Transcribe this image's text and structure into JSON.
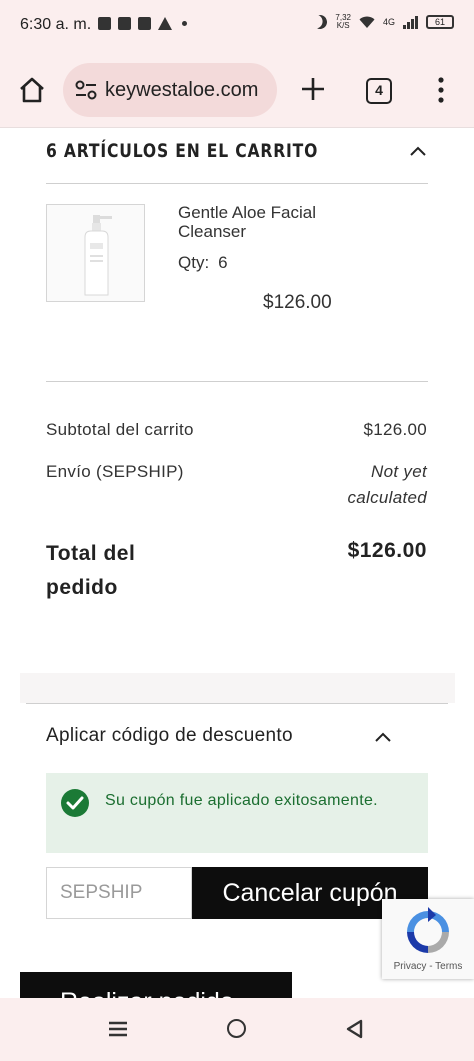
{
  "status_bar": {
    "time": "6:30 a. m.",
    "speed": "7,32",
    "speed_unit": "K/S",
    "network": "4G",
    "battery": "61"
  },
  "browser": {
    "url": "keywestaloe.com",
    "tab_count": "4"
  },
  "cart": {
    "heading": "6 ARTÍCULOS EN EL CARRITO",
    "item": {
      "name": "Gentle Aloe Facial Cleanser",
      "qty_label": "Qty:",
      "qty_value": "6",
      "price": "$126.00"
    }
  },
  "totals": {
    "subtotal_label": "Subtotal del carrito",
    "subtotal_value": "$126.00",
    "shipping_label": "Envío (SEPSHIP)",
    "shipping_value": "Not yet calculated",
    "total_label": "Total del pedido",
    "total_value": "$126.00"
  },
  "discount": {
    "heading": "Aplicar código de descuento",
    "success_message": "Su cupón fue aplicado exitosamente.",
    "coupon_value": "SEPSHIP",
    "cancel_label": "Cancelar cupón"
  },
  "recaptcha": {
    "links": "Privacy - Terms"
  },
  "checkout": {
    "place_order_label": "Realizar pedido"
  },
  "colors": {
    "chrome_bg": "#fbeeee",
    "url_pill": "#f3dada",
    "success_bg": "#e6f1e8",
    "success_icon": "#1b7a36",
    "button_bg": "#0d0d0d"
  }
}
